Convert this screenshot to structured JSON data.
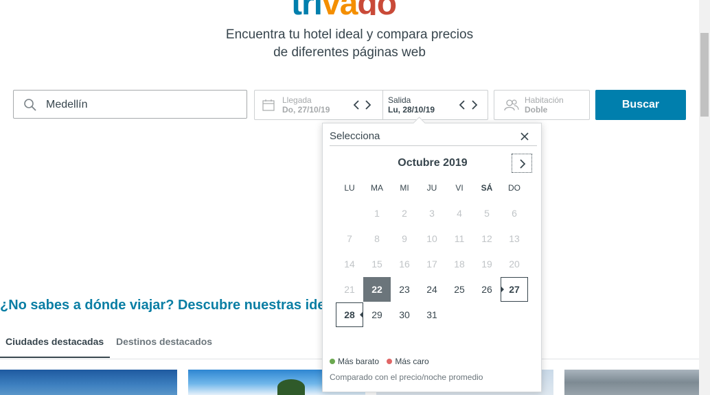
{
  "brand": {
    "part1": "tri",
    "part2": "va",
    "part3": "go",
    "colors": {
      "blue": "#007fad",
      "orange": "#f48f00",
      "red": "#c94a38"
    }
  },
  "headline": {
    "line1": "Encuentra tu hotel ideal y compara precios",
    "line2": "de diferentes páginas web"
  },
  "search": {
    "destination_value": "Medellín",
    "checkin_label": "Llegada",
    "checkin_value": "Do, 27/10/19",
    "checkout_label": "Salida",
    "checkout_value": "Lu, 28/10/19",
    "room_label": "Habitación",
    "room_value": "Doble",
    "button_label": "Buscar",
    "accent": "#007fad"
  },
  "calendar": {
    "header": "Selecciona",
    "month": "Octubre 2019",
    "weekdays": [
      "LU",
      "MA",
      "MI",
      "JU",
      "VI",
      "SÁ",
      "DO"
    ],
    "weeks": [
      [
        "",
        "1",
        "2",
        "3",
        "4",
        "5",
        "6"
      ],
      [
        "7",
        "8",
        "9",
        "10",
        "11",
        "12",
        "13"
      ],
      [
        "14",
        "15",
        "16",
        "17",
        "18",
        "19",
        "20"
      ],
      [
        "21",
        "22",
        "23",
        "24",
        "25",
        "26",
        "27"
      ],
      [
        "28",
        "29",
        "30",
        "31",
        "",
        "",
        ""
      ]
    ],
    "today": "22",
    "checkin_day": "27",
    "checkout_day": "28",
    "legend_cheap": "Más barato",
    "legend_expensive": "Más caro",
    "legend_cheap_color": "#6aa84f",
    "legend_expensive_color": "#e06666",
    "note": "Comparado con el precio/noche promedio"
  },
  "discover": {
    "title": "¿No sabes a dónde viajar? Descubre nuestras ide"
  },
  "tabs": [
    {
      "label": "Ciudades destacadas"
    },
    {
      "label": "Destinos destacados"
    }
  ]
}
